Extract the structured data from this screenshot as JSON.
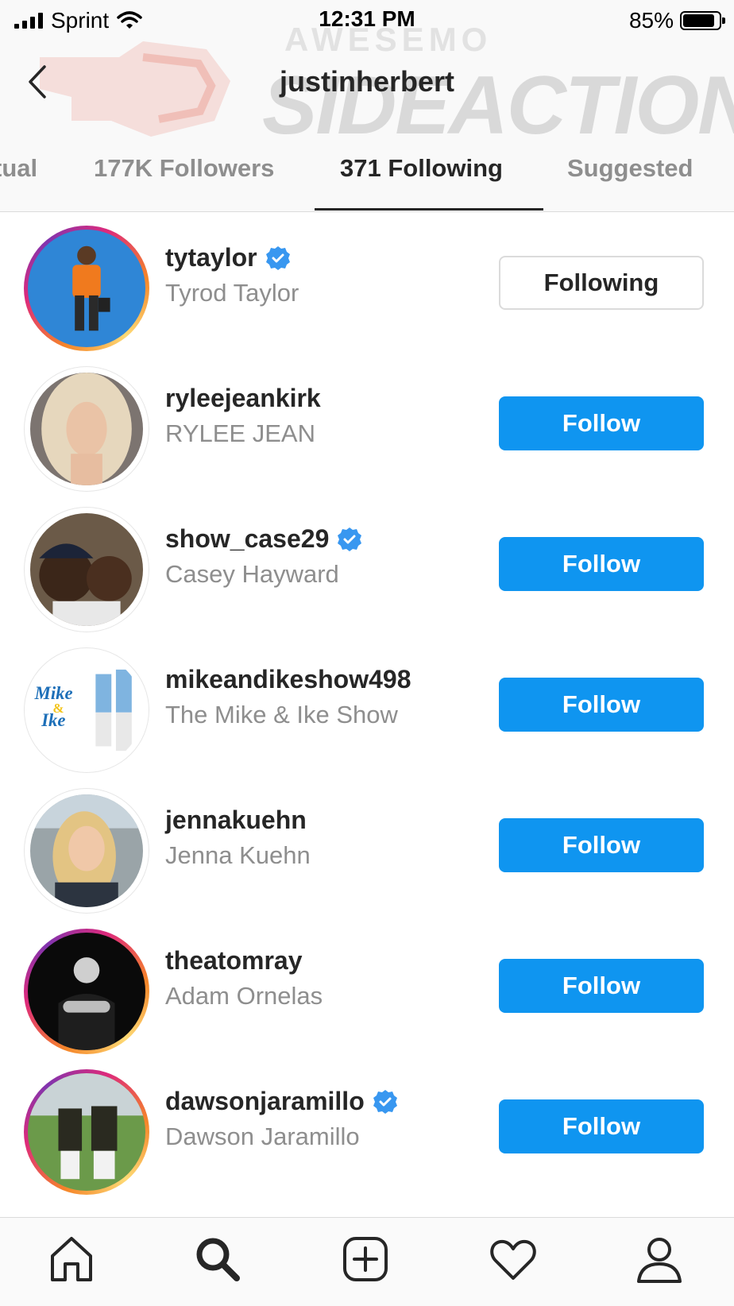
{
  "status_bar": {
    "carrier": "Sprint",
    "time": "12:31 PM",
    "battery": "85%",
    "battery_level": 0.85
  },
  "watermark": {
    "line1": "AWESEMO",
    "line2": "SIDEACTION"
  },
  "header": {
    "title": "justinherbert",
    "back_icon": "chevron-left-icon"
  },
  "tabs": [
    {
      "label": "tual"
    },
    {
      "label": "177K Followers"
    },
    {
      "label": "371 Following",
      "active": true
    },
    {
      "label": "Suggested"
    }
  ],
  "accounts": [
    {
      "username": "tytaylor",
      "full_name": "Tyrod Taylor",
      "verified": true,
      "story_ring": true,
      "button": "Following"
    },
    {
      "username": "ryleejeankirk",
      "full_name": "RYLEE JEAN",
      "verified": false,
      "story_ring": false,
      "button": "Follow"
    },
    {
      "username": "show_case29",
      "full_name": "Casey Hayward",
      "verified": true,
      "story_ring": false,
      "button": "Follow"
    },
    {
      "username": "mikeandikeshow498",
      "full_name": "The Mike & Ike Show",
      "verified": false,
      "story_ring": false,
      "button": "Follow",
      "avatar_text": [
        "Mike",
        "&",
        "Ike"
      ]
    },
    {
      "username": "jennakuehn",
      "full_name": "Jenna Kuehn",
      "verified": false,
      "story_ring": false,
      "button": "Follow"
    },
    {
      "username": "theatomray",
      "full_name": "Adam Ornelas",
      "verified": false,
      "story_ring": true,
      "button": "Follow"
    },
    {
      "username": "dawsonjaramillo",
      "full_name": "Dawson Jaramillo",
      "verified": true,
      "story_ring": true,
      "button": "Follow"
    }
  ],
  "bottom_nav": [
    "home-icon",
    "search-icon",
    "new-post-icon",
    "activity-heart-icon",
    "profile-icon"
  ],
  "colors": {
    "follow_blue": "#0f95f0",
    "verified_blue": "#3897f0",
    "secondary_text": "#8e8e8e"
  }
}
